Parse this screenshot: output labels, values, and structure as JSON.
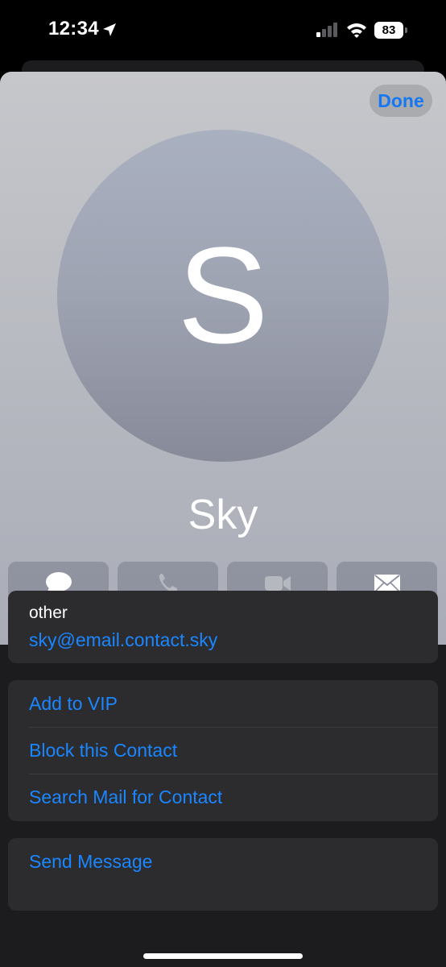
{
  "status_bar": {
    "time": "12:34",
    "battery": "83"
  },
  "header": {
    "done_label": "Done"
  },
  "contact": {
    "initial": "S",
    "name": "Sky"
  },
  "actions": [
    {
      "label": "message",
      "icon": "message-bubble-icon",
      "enabled": true
    },
    {
      "label": "call",
      "icon": "phone-icon",
      "enabled": false
    },
    {
      "label": "video",
      "icon": "video-camera-icon",
      "enabled": false
    },
    {
      "label": "mail",
      "icon": "envelope-icon",
      "enabled": true
    }
  ],
  "email": {
    "type": "other",
    "address": "sky@email.contact.sky"
  },
  "options": [
    {
      "label": "Add to VIP"
    },
    {
      "label": "Block this Contact"
    },
    {
      "label": "Search Mail for Contact"
    }
  ],
  "send": {
    "label": "Send Message"
  },
  "colors": {
    "accent": "#1a86ff",
    "background": "#000000",
    "card": "#2c2c2e"
  }
}
